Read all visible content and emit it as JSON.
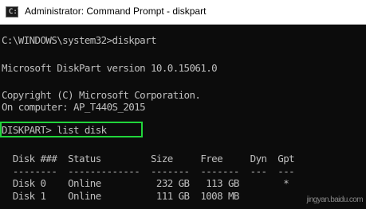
{
  "window": {
    "title": "Administrator: Command Prompt - diskpart"
  },
  "console": {
    "lines": [
      "C:\\WINDOWS\\system32>diskpart",
      "Microsoft DiskPart version 10.0.15061.0",
      "Copyright (C) Microsoft Corporation.",
      "On computer: AP_T440S_2015",
      "DISKPART> list disk",
      "  Disk ###  Status         Size     Free     Dyn  Gpt",
      "  --------  -------------  -------  -------  ---  ---",
      "  Disk 0    Online          232 GB   113 GB        *",
      "  Disk 1    Online          111 GB  1008 MB"
    ]
  },
  "watermark": {
    "text": "jingyan.baidu.com"
  },
  "colors": {
    "console_bg": "#0c0c0c",
    "console_text": "#c0c0c0",
    "highlight": "#21d53b"
  },
  "icons": {
    "title_icon": "command-prompt-icon"
  }
}
